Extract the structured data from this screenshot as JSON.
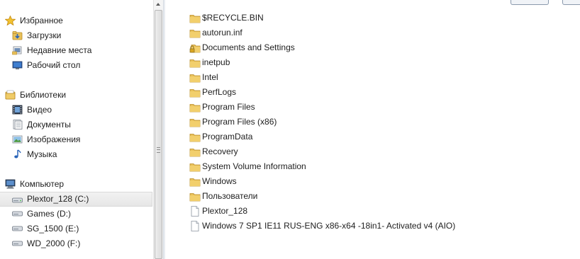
{
  "navigation": {
    "favorites": {
      "header": "Избранное",
      "items": [
        {
          "label": "Загрузки",
          "icon": "downloads-folder-icon"
        },
        {
          "label": "Недавние места",
          "icon": "recent-places-icon"
        },
        {
          "label": "Рабочий стол",
          "icon": "desktop-icon"
        }
      ]
    },
    "libraries": {
      "header": "Библиотеки",
      "items": [
        {
          "label": "Видео",
          "icon": "video-library-icon"
        },
        {
          "label": "Документы",
          "icon": "documents-library-icon"
        },
        {
          "label": "Изображения",
          "icon": "pictures-library-icon"
        },
        {
          "label": "Музыка",
          "icon": "music-library-icon"
        }
      ]
    },
    "computer": {
      "header": "Компьютер",
      "items": [
        {
          "label": "Plextor_128 (C:)",
          "icon": "drive-icon",
          "selected": true
        },
        {
          "label": "Games (D:)",
          "icon": "drive-icon"
        },
        {
          "label": "SG_1500 (E:)",
          "icon": "drive-icon"
        },
        {
          "label": "WD_2000 (F:)",
          "icon": "drive-icon"
        }
      ]
    }
  },
  "files": [
    {
      "name": "$RECYCLE.BIN",
      "type": "folder"
    },
    {
      "name": "autorun.inf",
      "type": "folder"
    },
    {
      "name": "Documents and Settings",
      "type": "locked-folder"
    },
    {
      "name": "inetpub",
      "type": "folder"
    },
    {
      "name": "Intel",
      "type": "folder"
    },
    {
      "name": "PerfLogs",
      "type": "folder"
    },
    {
      "name": "Program Files",
      "type": "folder"
    },
    {
      "name": "Program Files (x86)",
      "type": "folder"
    },
    {
      "name": "ProgramData",
      "type": "folder"
    },
    {
      "name": "Recovery",
      "type": "folder"
    },
    {
      "name": "System Volume Information",
      "type": "folder"
    },
    {
      "name": "Windows",
      "type": "folder"
    },
    {
      "name": "Пользователи",
      "type": "folder"
    },
    {
      "name": "Plextor_128",
      "type": "file"
    },
    {
      "name": "Windows 7 SP1 IE11 RUS-ENG x86-x64 -18in1- Activated v4 (AIO)",
      "type": "file"
    }
  ],
  "colors": {
    "folder": "#e8c15a",
    "folder_dark": "#c9962e",
    "selection": "#e6e6e6"
  }
}
